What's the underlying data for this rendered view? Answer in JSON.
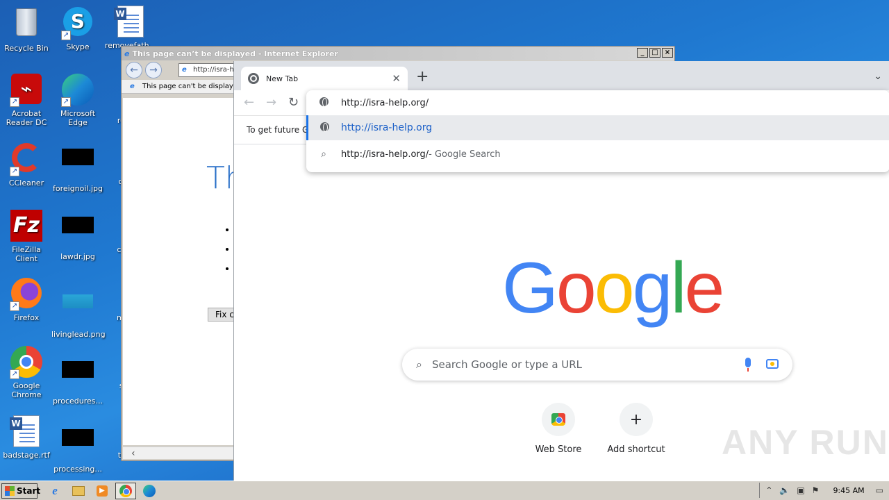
{
  "desktop": {
    "icons": [
      {
        "label": "Recycle Bin"
      },
      {
        "label": "Skype"
      },
      {
        "label": "removefath..."
      },
      {
        "label": "Acrobat Reader DC"
      },
      {
        "label": "Microsoft Edge"
      },
      {
        "label": "resta..."
      },
      {
        "label": "CCleaner"
      },
      {
        "label": "foreignoil.jpg"
      },
      {
        "label": "certi..."
      },
      {
        "label": "FileZilla Client"
      },
      {
        "label": "lawdr.jpg"
      },
      {
        "label": "choic..."
      },
      {
        "label": "Firefox"
      },
      {
        "label": "livinglead.png"
      },
      {
        "label": "millio..."
      },
      {
        "label": "Google Chrome"
      },
      {
        "label": "procedures..."
      },
      {
        "label": "secr..."
      },
      {
        "label": "badstage.rtf"
      },
      {
        "label": "processing..."
      },
      {
        "label": "term..."
      }
    ]
  },
  "ie_window": {
    "title": "This page can’t be displayed - Internet Explorer",
    "address": "http://isra-h",
    "tab_label": "This page can't be displayed",
    "big_text": "Th",
    "fix_button": "Fix c",
    "window_buttons": [
      "_",
      "□",
      "×"
    ]
  },
  "chrome": {
    "tab_title": "New Tab",
    "infobar_text": "To get future G",
    "omnibox": {
      "input_value": "http://isra-help.org/",
      "suggestions": [
        {
          "text": "http://isra-help.org",
          "suffix": "",
          "icon": "globe-icon"
        },
        {
          "text": "http://isra-help.org/",
          "suffix": " - Google Search",
          "icon": "search-icon"
        }
      ]
    },
    "ntp": {
      "logo_letters": [
        "G",
        "o",
        "o",
        "g",
        "l",
        "e"
      ],
      "logo_colors": [
        "#4285f4",
        "#ea4335",
        "#fbbc04",
        "#4285f4",
        "#34a853",
        "#ea4335"
      ],
      "search_placeholder": "Search Google or type a URL",
      "shortcuts": [
        {
          "label": "Web Store",
          "icon": "webstore-icon"
        },
        {
          "label": "Add shortcut",
          "icon": "plus-icon"
        }
      ]
    },
    "watermark": "ANY RUN"
  },
  "taskbar": {
    "start_label": "Start",
    "clock": "9:45 AM",
    "apps": [
      "internet-explorer",
      "file-explorer",
      "media-player",
      "google-chrome",
      "microsoft-edge"
    ]
  }
}
